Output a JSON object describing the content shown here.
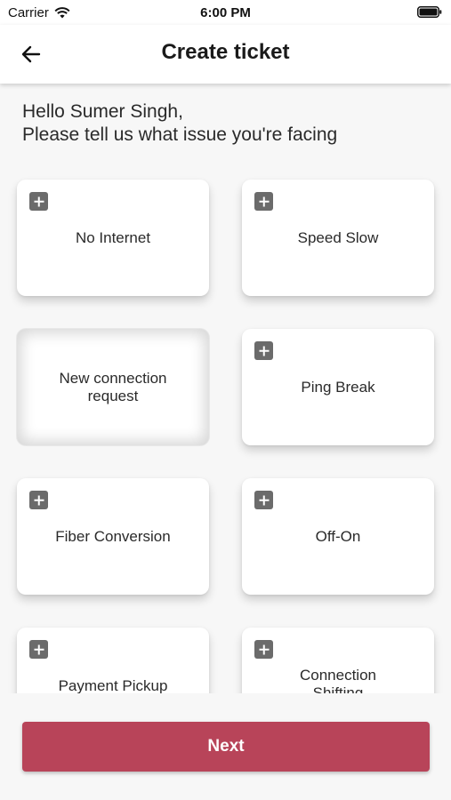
{
  "status_bar": {
    "carrier": "Carrier",
    "time": "6:00 PM"
  },
  "app_bar": {
    "title": "Create ticket",
    "back_icon": "arrow-left-icon"
  },
  "greeting": {
    "line1": "Hello Sumer Singh,",
    "line2": "Please tell us what issue you're facing"
  },
  "issues": [
    {
      "label": "No Internet",
      "icon": "plus-icon",
      "selected": false
    },
    {
      "label": "Speed Slow",
      "icon": "plus-icon",
      "selected": false
    },
    {
      "label": "New connection request",
      "icon": "",
      "selected": true
    },
    {
      "label": "Ping Break",
      "icon": "plus-icon",
      "selected": false
    },
    {
      "label": "Fiber Conversion",
      "icon": "plus-icon",
      "selected": false
    },
    {
      "label": "Off-On",
      "icon": "plus-icon",
      "selected": false
    },
    {
      "label": "Payment Pickup",
      "icon": "plus-icon",
      "selected": false
    },
    {
      "label": "Connection Shifting",
      "icon": "plus-icon",
      "selected": false
    }
  ],
  "footer": {
    "next_label": "Next"
  },
  "colors": {
    "accent": "#b84459",
    "plus_icon": "#6b6b6b",
    "background": "#f7f7f7"
  }
}
